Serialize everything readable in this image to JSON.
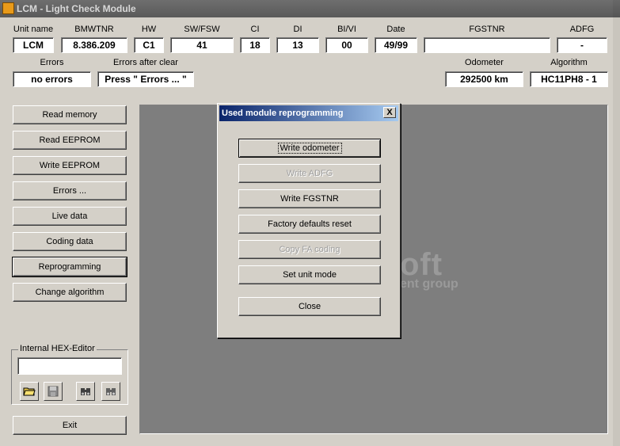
{
  "window": {
    "title": "LCM - Light Check Module"
  },
  "header": {
    "labels": {
      "unit_name": "Unit name",
      "bmwtnr": "BMWTNR",
      "hw": "HW",
      "sw_fsw": "SW/FSW",
      "ci": "CI",
      "di": "DI",
      "bi_vi": "BI/VI",
      "date": "Date",
      "fgstnr": "FGSTNR",
      "adfg": "ADFG",
      "errors": "Errors",
      "errors_after_clear": "Errors after clear",
      "odometer": "Odometer",
      "algorithm": "Algorithm"
    },
    "values": {
      "unit_name": "LCM",
      "bmwtnr": "8.386.209",
      "hw": "C1",
      "sw_fsw": "41",
      "ci": "18",
      "di": "13",
      "bi_vi": "00",
      "date": "49/99",
      "fgstnr": "",
      "adfg": "-",
      "errors": "no errors",
      "errors_after_clear": "Press \" Errors ... \"",
      "odometer": "292500 km",
      "algorithm": "HC11PH8 - 1"
    }
  },
  "sidebar": {
    "buttons": [
      "Read memory",
      "Read EEPROM",
      "Write EEPROM",
      "Errors ...",
      "Live data",
      "Coding data",
      "Reprogramming",
      "Change algorithm"
    ],
    "hex_editor": {
      "label": "Internal HEX-Editor",
      "value": ""
    },
    "exit": "Exit"
  },
  "logo": {
    "line1": "oft",
    "line2": "ent group"
  },
  "dialog": {
    "title": "Used module reprogramming",
    "close_glyph": "X",
    "buttons": {
      "write_odometer": "Write odometer",
      "write_adfg": "Write ADFG",
      "write_fgstnr": "Write FGSTNR",
      "factory_reset": "Factory defaults reset",
      "copy_fa": "Copy FA coding",
      "set_unit_mode": "Set unit mode",
      "close": "Close"
    }
  }
}
